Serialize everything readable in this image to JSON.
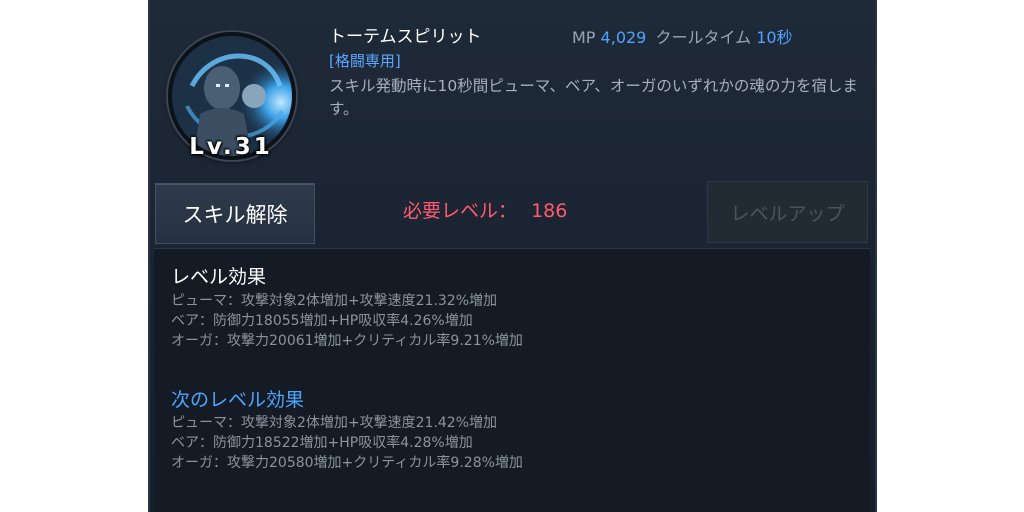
{
  "skill": {
    "name": "トーテムスピリット",
    "level_badge": "Lv.31",
    "tag": "[格闘専用]",
    "description": "スキル発動時に10秒間ピューマ、ベア、オーガのいずれかの魂の力を宿します。"
  },
  "stats": {
    "mp_label": "MP",
    "mp_value": "4,029",
    "cooldown_label": "クールタイム",
    "cooldown_value": "10秒"
  },
  "actions": {
    "release_label": "スキル解除",
    "required_level_label": "必要レベル：",
    "required_level_value": "186",
    "levelup_label": "レベルアップ"
  },
  "current_effects": {
    "title": "レベル効果",
    "lines": [
      "ピューマ：攻撃対象2体増加+攻撃速度21.32%増加",
      "ベア：防御力18055増加+HP吸収率4.26%増加",
      "オーガ：攻撃力20061増加+クリティカル率9.21%増加"
    ]
  },
  "next_effects": {
    "title": "次のレベル効果",
    "lines": [
      "ピューマ：攻撃対象2体増加+攻撃速度21.42%増加",
      "ベア：防御力18522増加+HP吸収率4.28%増加",
      "オーガ：攻撃力20580増加+クリティカル率9.28%増加"
    ]
  },
  "colors": {
    "accent_blue": "#4ea3ff",
    "required_red": "#ff5b6e",
    "panel_bg": "#1b2533"
  },
  "icons": {
    "skill_icon": "totem-spirit-skill-icon"
  }
}
